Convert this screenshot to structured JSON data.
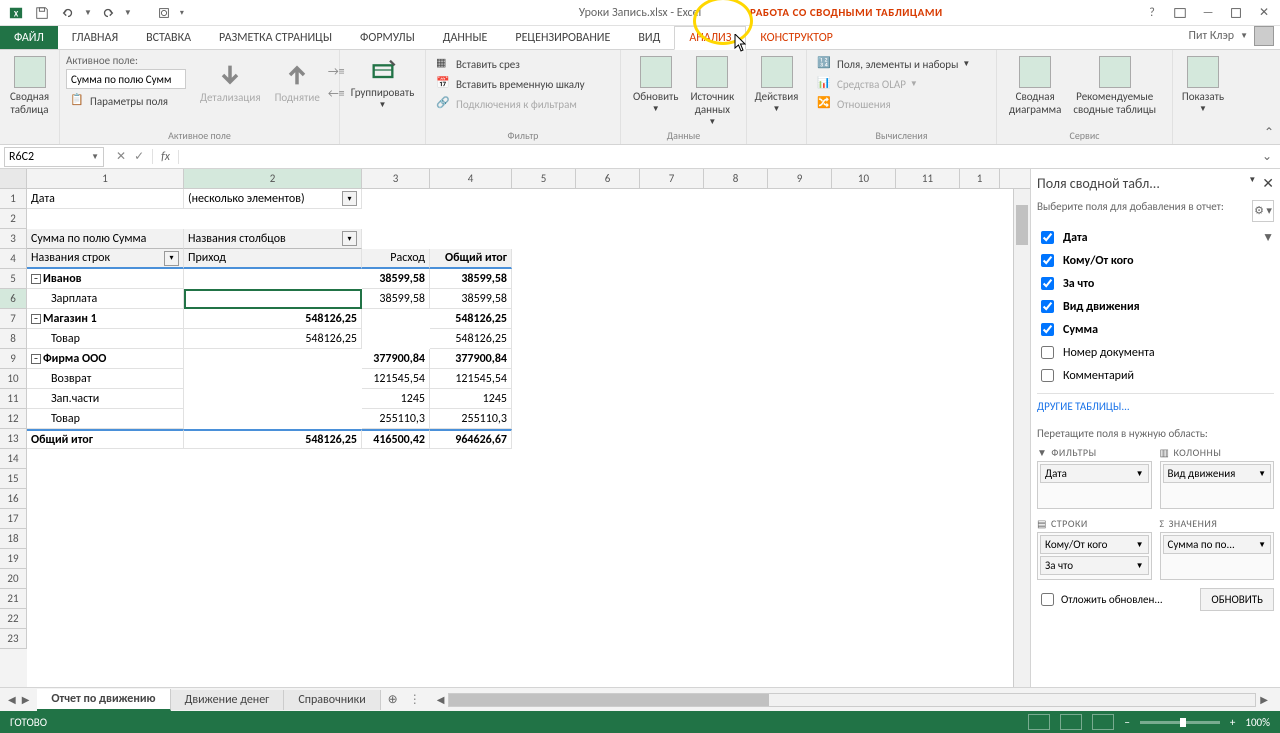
{
  "titlebar": {
    "title": "Уроки Запись.xlsx - Excel",
    "contextual": "РАБОТА СО СВОДНЫМИ ТАБЛИЦАМИ"
  },
  "tabs": {
    "file": "ФАЙЛ",
    "items": [
      "ГЛАВНАЯ",
      "ВСТАВКА",
      "РАЗМЕТКА СТРАНИЦЫ",
      "ФОРМУЛЫ",
      "ДАННЫЕ",
      "РЕЦЕНЗИРОВАНИЕ",
      "ВИД",
      "АНАЛИЗ",
      "КОНСТРУКТОР"
    ],
    "activeIndex": 7,
    "user": "Пит Клэр"
  },
  "ribbon": {
    "active_field_label": "Активное поле:",
    "active_field_value": "Сумма по полю Сумм",
    "field_params": "Параметры поля",
    "pivot_table": "Сводная\nтаблица",
    "detail": "Детализация",
    "collapse": "Поднятие",
    "group": "Группировать",
    "group_label": "Активное поле",
    "insert_slicer": "Вставить срез",
    "insert_timeline": "Вставить временную шкалу",
    "filter_conn": "Подключения к фильтрам",
    "filter_label": "Фильтр",
    "refresh": "Обновить",
    "data_source": "Источник\nданных",
    "data_label": "Данные",
    "actions": "Действия",
    "fields_items": "Поля, элементы и наборы",
    "olap": "Средства OLAP",
    "relationships": "Отношения",
    "calc_label": "Вычисления",
    "pivot_chart": "Сводная\nдиаграмма",
    "recommended": "Рекомендуемые\nсводные таблицы",
    "tools_label": "Сервис",
    "show": "Показать"
  },
  "namebox": "R6C2",
  "col_headers": [
    "1",
    "2",
    "3",
    "4",
    "5",
    "6",
    "7",
    "8",
    "9",
    "10",
    "11",
    "1"
  ],
  "rows": {
    "1": {
      "c1": "Дата",
      "c2": "(несколько элементов)"
    },
    "3": {
      "c1": "Сумма по полю Сумма",
      "c2": "Названия столбцов"
    },
    "4": {
      "c1": "Названия строк",
      "c2": "Приход",
      "c3": "Расход",
      "c4": "Общий итог"
    },
    "5": {
      "c1": "Иванов",
      "c3": "38599,58",
      "c4": "38599,58"
    },
    "6": {
      "c1": "Зарплата",
      "c3": "38599,58",
      "c4": "38599,58"
    },
    "7": {
      "c1": "Магазин 1",
      "c2": "548126,25",
      "c4": "548126,25"
    },
    "8": {
      "c1": "Товар",
      "c2": "548126,25",
      "c4": "548126,25"
    },
    "9": {
      "c1": "Фирма ООО",
      "c3": "377900,84",
      "c4": "377900,84"
    },
    "10": {
      "c1": "Возврат",
      "c3": "121545,54",
      "c4": "121545,54"
    },
    "11": {
      "c1": "Зап.части",
      "c3": "1245",
      "c4": "1245"
    },
    "12": {
      "c1": "Товар",
      "c3": "255110,3",
      "c4": "255110,3"
    },
    "13": {
      "c1": "Общий итог",
      "c2": "548126,25",
      "c3": "416500,42",
      "c4": "964626,67"
    }
  },
  "field_pane": {
    "title": "Поля сводной табл...",
    "subtitle": "Выберите поля для добавления в отчет:",
    "fields": [
      {
        "label": "Дата",
        "checked": true,
        "filter": true
      },
      {
        "label": "Кому/От кого",
        "checked": true
      },
      {
        "label": "За что",
        "checked": true
      },
      {
        "label": "Вид движения",
        "checked": true
      },
      {
        "label": "Сумма",
        "checked": true
      },
      {
        "label": "Номер документа",
        "checked": false
      },
      {
        "label": "Комментарий",
        "checked": false
      }
    ],
    "other_tables": "ДРУГИЕ ТАБЛИЦЫ...",
    "drag_hint": "Перетащите поля в нужную область:",
    "areas": {
      "filters": "ФИЛЬТРЫ",
      "columns": "КОЛОННЫ",
      "rows": "СТРОКИ",
      "values": "ЗНАЧЕНИЯ"
    },
    "filter_pills": [
      "Дата"
    ],
    "column_pills": [
      "Вид движения"
    ],
    "row_pills": [
      "Кому/От кого",
      "За что"
    ],
    "value_pills": [
      "Сумма по по..."
    ],
    "defer": "Отложить обновлен...",
    "update": "ОБНОВИТЬ"
  },
  "sheets": {
    "tabs": [
      "Отчет по движению",
      "Движение денег",
      "Справочники"
    ],
    "active": 0
  },
  "status": {
    "ready": "ГОТОВО",
    "zoom": "100%"
  }
}
